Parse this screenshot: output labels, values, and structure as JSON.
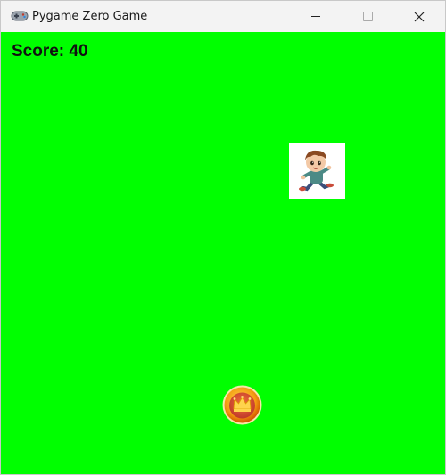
{
  "window": {
    "title": "Pygame Zero Game",
    "icon": "gamepad-icon",
    "controls": [
      "minimize-icon",
      "maximize-icon",
      "close-icon"
    ]
  },
  "game": {
    "background_color": "#00ff00",
    "score_text": "Score: 40",
    "sprites": {
      "player": "running-boy-sprite",
      "coin": "crown-coin-sprite"
    }
  }
}
